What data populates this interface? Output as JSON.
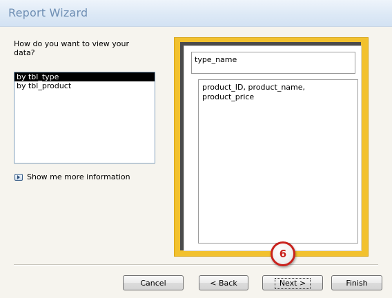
{
  "window": {
    "title": "Report Wizard"
  },
  "prompt": "How do you want to view your data?",
  "view_options": [
    {
      "label": "by tbl_type",
      "selected": true
    },
    {
      "label": "by tbl_product",
      "selected": false
    }
  ],
  "more_info_link": "Show me more information",
  "preview": {
    "group_header": "type_name",
    "detail_fields": "product_ID, product_name, product_price"
  },
  "buttons": {
    "cancel": "Cancel",
    "back": "< Back",
    "next": "Next >",
    "finish": "Finish"
  },
  "callout": {
    "number": "6",
    "color": "#c9221d"
  },
  "colors": {
    "title_text": "#6f8fb4",
    "preview_frame": "#f2c12e",
    "selection": "#000000"
  }
}
